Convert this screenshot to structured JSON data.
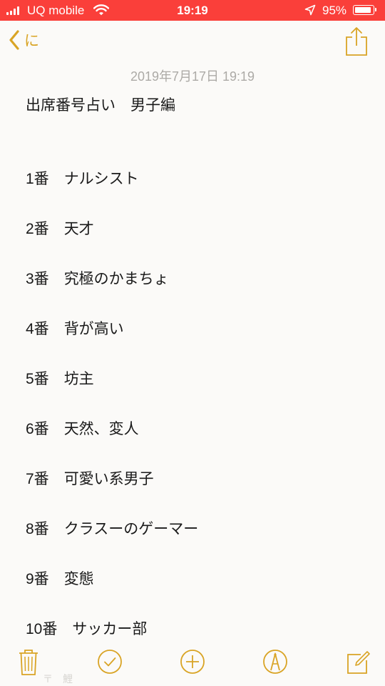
{
  "status_bar": {
    "carrier": "UQ mobile",
    "time": "19:19",
    "battery_percent": "95%",
    "battery_level": 0.95,
    "icons": [
      "signal-icon",
      "wifi-icon",
      "location-arrow-icon",
      "battery-icon"
    ]
  },
  "nav": {
    "back_label": "に",
    "back_icon": "chevron-left-icon",
    "share_icon": "share-icon"
  },
  "note": {
    "date": "2019年7月17日 19:19",
    "title": "出席番号占い　男子編",
    "lines": [
      {
        "number": "1番",
        "text": "ナルシスト"
      },
      {
        "number": "2番",
        "text": "天才"
      },
      {
        "number": "3番",
        "text": "究極のかまちょ"
      },
      {
        "number": "4番",
        "text": "背が高い"
      },
      {
        "number": "5番",
        "text": "坊主"
      },
      {
        "number": "6番",
        "text": "天然、変人"
      },
      {
        "number": "7番",
        "text": "可愛い系男子"
      },
      {
        "number": "8番",
        "text": "クラスーのゲーマー"
      },
      {
        "number": "9番",
        "text": "変態"
      },
      {
        "number": "10番",
        "text": "サッカー部"
      }
    ]
  },
  "toolbar": {
    "icons": [
      "trash-icon",
      "checklist-icon",
      "add-icon",
      "markup-icon",
      "compose-icon"
    ]
  },
  "colors": {
    "status_bar": "#fa3f3a",
    "accent": "#d9a425",
    "background": "#fbfaf8",
    "text": "#1a1a1a",
    "date_text": "#acaaa6"
  }
}
